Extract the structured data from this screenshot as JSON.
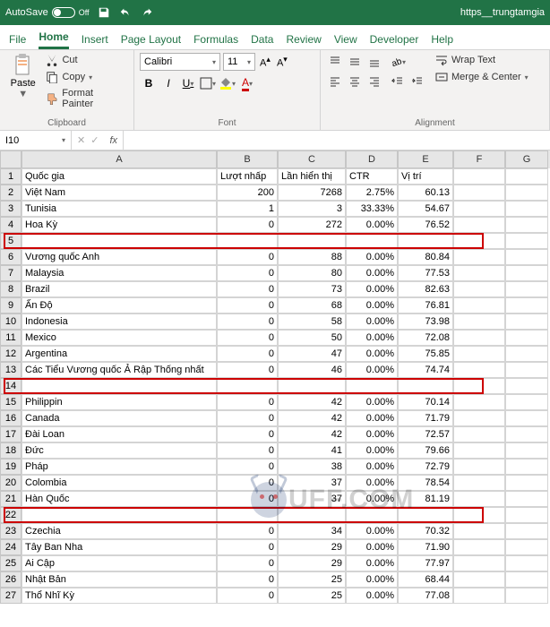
{
  "titlebar": {
    "autosave": "AutoSave",
    "autosave_state": "Off",
    "docname": "https__trungtamgia"
  },
  "tabs": [
    "File",
    "Home",
    "Insert",
    "Page Layout",
    "Formulas",
    "Data",
    "Review",
    "View",
    "Developer",
    "Help"
  ],
  "active_tab": 1,
  "ribbon": {
    "paste": "Paste",
    "cut": "Cut",
    "copy": "Copy",
    "format_painter": "Format Painter",
    "clipboard": "Clipboard",
    "font_name": "Calibri",
    "font_size": "11",
    "font_group": "Font",
    "wrap_text": "Wrap Text",
    "merge_center": "Merge & Center",
    "alignment": "Alignment"
  },
  "namebox": "I10",
  "columns": [
    "A",
    "B",
    "C",
    "D",
    "E",
    "F",
    "G"
  ],
  "headers": [
    "Quốc gia",
    "Lượt nhấp",
    "Lần hiển thị",
    "CTR",
    "Vị trí"
  ],
  "rows": [
    {
      "n": 1,
      "a": "Quốc gia",
      "b": "Lượt nhấp",
      "c": "Lần hiển thị",
      "d": "CTR",
      "e": "Vị trí"
    },
    {
      "n": 2,
      "a": "Việt Nam",
      "b": "200",
      "c": "7268",
      "d": "2.75%",
      "e": "60.13"
    },
    {
      "n": 3,
      "a": "Tunisia",
      "b": "1",
      "c": "3",
      "d": "33.33%",
      "e": "54.67"
    },
    {
      "n": 4,
      "a": "Hoa Kỳ",
      "b": "0",
      "c": "272",
      "d": "0.00%",
      "e": "76.52"
    },
    {
      "n": 5,
      "a": "",
      "b": "",
      "c": "",
      "d": "",
      "e": "",
      "blank": true
    },
    {
      "n": 6,
      "a": "Vương quốc Anh",
      "b": "0",
      "c": "88",
      "d": "0.00%",
      "e": "80.84"
    },
    {
      "n": 7,
      "a": "Malaysia",
      "b": "0",
      "c": "80",
      "d": "0.00%",
      "e": "77.53"
    },
    {
      "n": 8,
      "a": "Brazil",
      "b": "0",
      "c": "73",
      "d": "0.00%",
      "e": "82.63"
    },
    {
      "n": 9,
      "a": "Ấn Độ",
      "b": "0",
      "c": "68",
      "d": "0.00%",
      "e": "76.81"
    },
    {
      "n": 10,
      "a": "Indonesia",
      "b": "0",
      "c": "58",
      "d": "0.00%",
      "e": "73.98"
    },
    {
      "n": 11,
      "a": "Mexico",
      "b": "0",
      "c": "50",
      "d": "0.00%",
      "e": "72.08"
    },
    {
      "n": 12,
      "a": "Argentina",
      "b": "0",
      "c": "47",
      "d": "0.00%",
      "e": "75.85"
    },
    {
      "n": 13,
      "a": "Các Tiểu Vương quốc Ả Rập Thống nhất",
      "b": "0",
      "c": "46",
      "d": "0.00%",
      "e": "74.74"
    },
    {
      "n": 14,
      "a": "",
      "b": "",
      "c": "",
      "d": "",
      "e": "",
      "blank": true
    },
    {
      "n": 15,
      "a": "Philippin",
      "b": "0",
      "c": "42",
      "d": "0.00%",
      "e": "70.14"
    },
    {
      "n": 16,
      "a": "Canada",
      "b": "0",
      "c": "42",
      "d": "0.00%",
      "e": "71.79"
    },
    {
      "n": 17,
      "a": "Đài Loan",
      "b": "0",
      "c": "42",
      "d": "0.00%",
      "e": "72.57"
    },
    {
      "n": 18,
      "a": "Đức",
      "b": "0",
      "c": "41",
      "d": "0.00%",
      "e": "79.66"
    },
    {
      "n": 19,
      "a": "Pháp",
      "b": "0",
      "c": "38",
      "d": "0.00%",
      "e": "72.79"
    },
    {
      "n": 20,
      "a": "Colombia",
      "b": "0",
      "c": "37",
      "d": "0.00%",
      "e": "78.54"
    },
    {
      "n": 21,
      "a": "Hàn Quốc",
      "b": "0",
      "c": "37",
      "d": "0.00%",
      "e": "81.19"
    },
    {
      "n": 22,
      "a": "",
      "b": "",
      "c": "",
      "d": "",
      "e": "",
      "blank": true
    },
    {
      "n": 23,
      "a": "Czechia",
      "b": "0",
      "c": "34",
      "d": "0.00%",
      "e": "70.32"
    },
    {
      "n": 24,
      "a": "Tây Ban Nha",
      "b": "0",
      "c": "29",
      "d": "0.00%",
      "e": "71.90"
    },
    {
      "n": 25,
      "a": "Ai Cập",
      "b": "0",
      "c": "29",
      "d": "0.00%",
      "e": "77.97"
    },
    {
      "n": 26,
      "a": "Nhật Bản",
      "b": "0",
      "c": "25",
      "d": "0.00%",
      "e": "68.44"
    },
    {
      "n": 27,
      "a": "Thổ Nhĩ Kỳ",
      "b": "0",
      "c": "25",
      "d": "0.00%",
      "e": "77.08"
    }
  ],
  "watermark": "UFF.COM"
}
